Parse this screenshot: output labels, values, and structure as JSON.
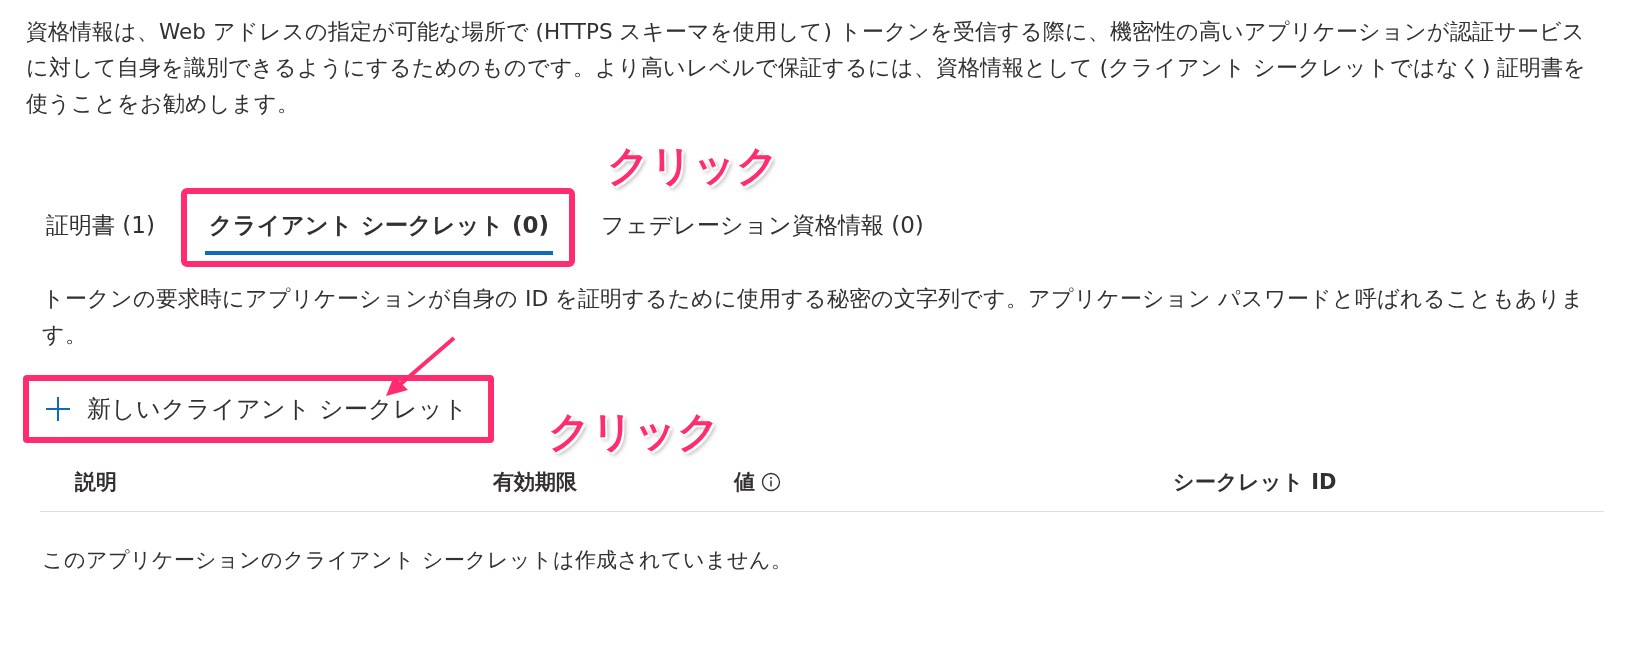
{
  "intro": "資格情報は、Web アドレスの指定が可能な場所で (HTTPS スキーマを使用して) トークンを受信する際に、機密性の高いアプリケーションが認証サービスに対して自身を識別できるようにするためのものです。より高いレベルで保証するには、資格情報として (クライアント シークレットではなく) 証明書を使うことをお勧めします。",
  "tabs": [
    {
      "label": "証明書 (1)",
      "selected": false
    },
    {
      "label": "クライアント シークレット (0)",
      "selected": true
    },
    {
      "label": "フェデレーション資格情報 (0)",
      "selected": false
    }
  ],
  "description": "トークンの要求時にアプリケーションが自身の ID を証明するために使用する秘密の文字列です。アプリケーション パスワードと呼ばれることもあります。",
  "new_button": {
    "label": "新しいクライアント シークレット"
  },
  "table": {
    "columns": [
      {
        "label": "説明",
        "info": false
      },
      {
        "label": "有効期限",
        "info": false
      },
      {
        "label": "値",
        "info": true
      },
      {
        "label": "シークレット ID",
        "info": false
      }
    ],
    "empty_message": "このアプリケーションのクライアント シークレットは作成されていません。"
  },
  "annotations": [
    {
      "text": "クリック"
    },
    {
      "text": "クリック"
    }
  ]
}
